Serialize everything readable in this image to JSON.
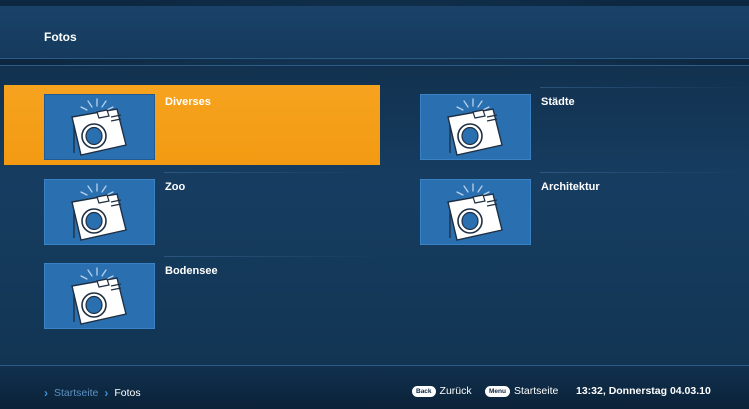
{
  "header": {
    "title": "Fotos"
  },
  "albums": [
    {
      "label": "Diverses",
      "selected": true
    },
    {
      "label": "Städte",
      "selected": false
    },
    {
      "label": "Zoo",
      "selected": false
    },
    {
      "label": "Architektur",
      "selected": false
    },
    {
      "label": "Bodensee",
      "selected": false
    }
  ],
  "footer": {
    "breadcrumb": [
      "Startseite",
      "Fotos"
    ],
    "back": {
      "key": "Back",
      "label": "Zurück"
    },
    "menu": {
      "key": "Menu",
      "label": "Startseite"
    },
    "clock": "13:32, Donnerstag 04.03.10"
  },
  "colors": {
    "accent": "#f6a31f",
    "background": "#143757",
    "thumb": "#2a6fb0"
  },
  "icons": {
    "album_thumb": "camera-icon",
    "crumb_separator": "chevron-right-icon"
  }
}
